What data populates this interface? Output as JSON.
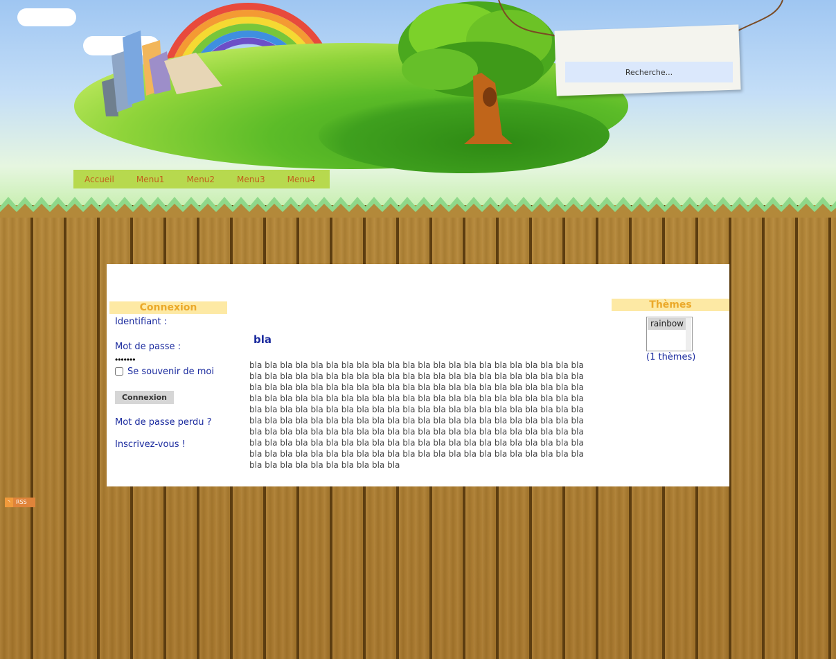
{
  "header": {
    "search_placeholder": "Recherche...",
    "nav": [
      "Accueil",
      "Menu1",
      "Menu2",
      "Menu3",
      "Menu4"
    ]
  },
  "login": {
    "title": "Connexion",
    "username_label": "Identifiant :",
    "password_label": "Mot de passe :",
    "password_value": "•••••••",
    "remember_label": "Se souvenir de moi",
    "submit_label": "Connexion",
    "forgot_label": "Mot de passe perdu ?",
    "register_label": "Inscrivez-vous !"
  },
  "article": {
    "title": "bla",
    "body": "bla bla bla bla bla bla bla bla bla bla bla bla bla bla bla bla bla bla bla bla bla bla bla bla bla bla bla bla bla bla bla bla bla bla bla bla bla bla bla bla bla bla bla bla bla bla bla bla bla bla bla bla bla bla bla bla bla bla bla bla bla bla bla bla bla bla bla bla bla bla bla bla bla bla bla bla bla bla bla bla bla bla bla bla bla bla bla bla bla bla bla bla bla bla bla bla bla bla bla bla bla bla bla bla bla bla bla bla bla bla bla bla bla bla bla bla bla bla bla bla bla bla bla bla bla bla bla bla bla bla bla bla bla bla bla bla bla bla bla bla bla bla bla bla bla bla bla bla bla bla bla bla bla bla bla bla bla bla bla bla bla bla bla bla bla bla bla bla bla bla bla bla bla bla bla bla bla bla bla bla bla bla bla bla bla bla bla bla bla bla bla bla bla bla bla bla bla bla bla bla bla bla bla bla bla bla bla bla"
  },
  "themes": {
    "title": "Thèmes",
    "selected": "rainbow",
    "count_label": "(1 thèmes)"
  },
  "rss": {
    "label": "RSS"
  },
  "colors": {
    "link": "#1a2a9e",
    "box_title_bg": "#fde9a4",
    "box_title_text": "#eba92a",
    "nav_bg": "#b7d94e",
    "nav_text": "#c15f1d"
  }
}
